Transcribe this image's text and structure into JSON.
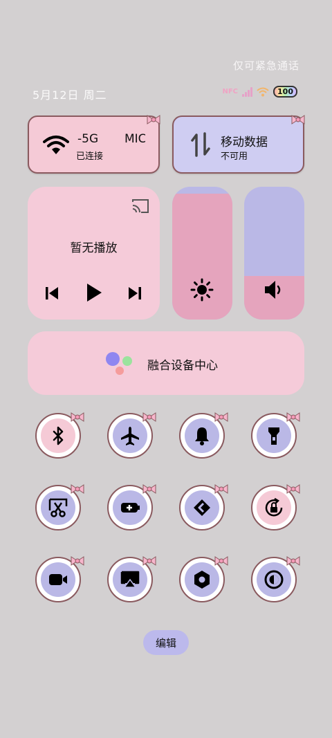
{
  "status_bar": {
    "emergency_text": "仅可紧急通话",
    "date": "5月12日 周二",
    "nfc_label": "NFC",
    "battery": "100"
  },
  "wifi_card": {
    "network_name": "-5G",
    "network_name_2": "MIC",
    "status": "已连接"
  },
  "data_card": {
    "title": "移动数据",
    "status": "不可用"
  },
  "media_card": {
    "status": "暂无播放"
  },
  "sliders": {
    "brightness_level": 0.95,
    "volume_level": 0.33
  },
  "fusion_card": {
    "label": "融合设备中心"
  },
  "toggles": [
    {
      "name": "bluetooth",
      "icon": "bluetooth-icon",
      "active": false
    },
    {
      "name": "airplane",
      "icon": "airplane-icon",
      "active": true
    },
    {
      "name": "ring",
      "icon": "bell-icon",
      "active": true
    },
    {
      "name": "flashlight",
      "icon": "flashlight-icon",
      "active": true
    },
    {
      "name": "screenshot",
      "icon": "screenshot-scissors-icon",
      "active": true
    },
    {
      "name": "battery-saver",
      "icon": "battery-plus-icon",
      "active": true
    },
    {
      "name": "nearby-share",
      "icon": "share-arrows-icon",
      "active": true
    },
    {
      "name": "auto-rotate",
      "icon": "rotation-lock-icon",
      "active": false
    },
    {
      "name": "screen-record",
      "icon": "video-camera-icon",
      "active": true
    },
    {
      "name": "screen-cast",
      "icon": "cast-screen-icon",
      "active": true
    },
    {
      "name": "settings-hex",
      "icon": "hexagon-icon",
      "active": true
    },
    {
      "name": "dark-mode",
      "icon": "contrast-icon",
      "active": true
    }
  ],
  "edit_label": "编辑",
  "colors": {
    "pink": "#f5cad6",
    "lavender": "#cfcdf2",
    "slider_pink": "#e5a4bd",
    "slider_lavender": "#bab8e6"
  }
}
